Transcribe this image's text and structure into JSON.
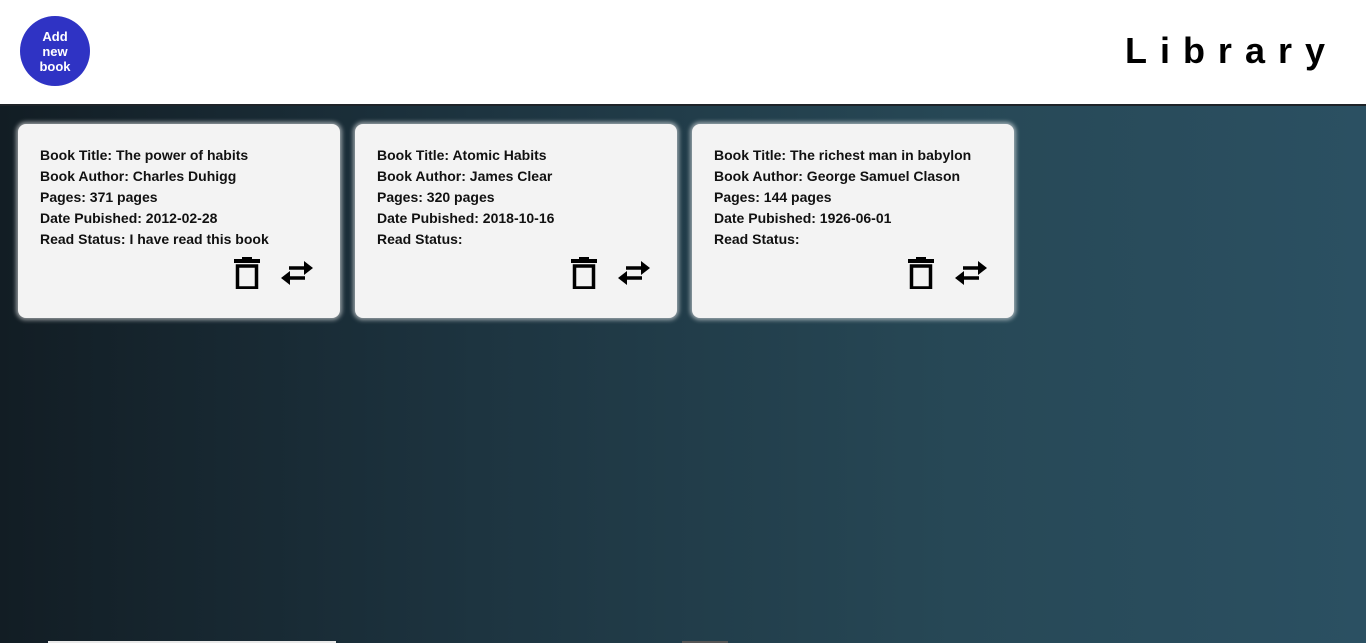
{
  "header": {
    "add_button_label": "Add new book",
    "title": "Library"
  },
  "books": [
    {
      "title_line": "Book Title: The power of habits",
      "author_line": "Book Author: Charles Duhigg",
      "pages_line": "Pages: 371 pages",
      "date_line": "Date Pubished: 2012-02-28",
      "status_line": "Read Status: I have read this book"
    },
    {
      "title_line": "Book Title: Atomic Habits",
      "author_line": "Book Author: James Clear",
      "pages_line": "Pages: 320 pages",
      "date_line": "Date Pubished: 2018-10-16",
      "status_line": "Read Status:"
    },
    {
      "title_line": "Book Title: The richest man in babylon",
      "author_line": "Book Author: George Samuel Clason",
      "pages_line": "Pages: 144 pages",
      "date_line": "Date Pubished: 1926-06-01",
      "status_line": "Read Status:"
    }
  ],
  "icons": {
    "delete": "trash-icon",
    "toggle": "swap-arrows-icon"
  },
  "colors": {
    "accent": "#2f33c4",
    "card_bg": "#f3f3f3",
    "header_bg": "#ffffff"
  }
}
